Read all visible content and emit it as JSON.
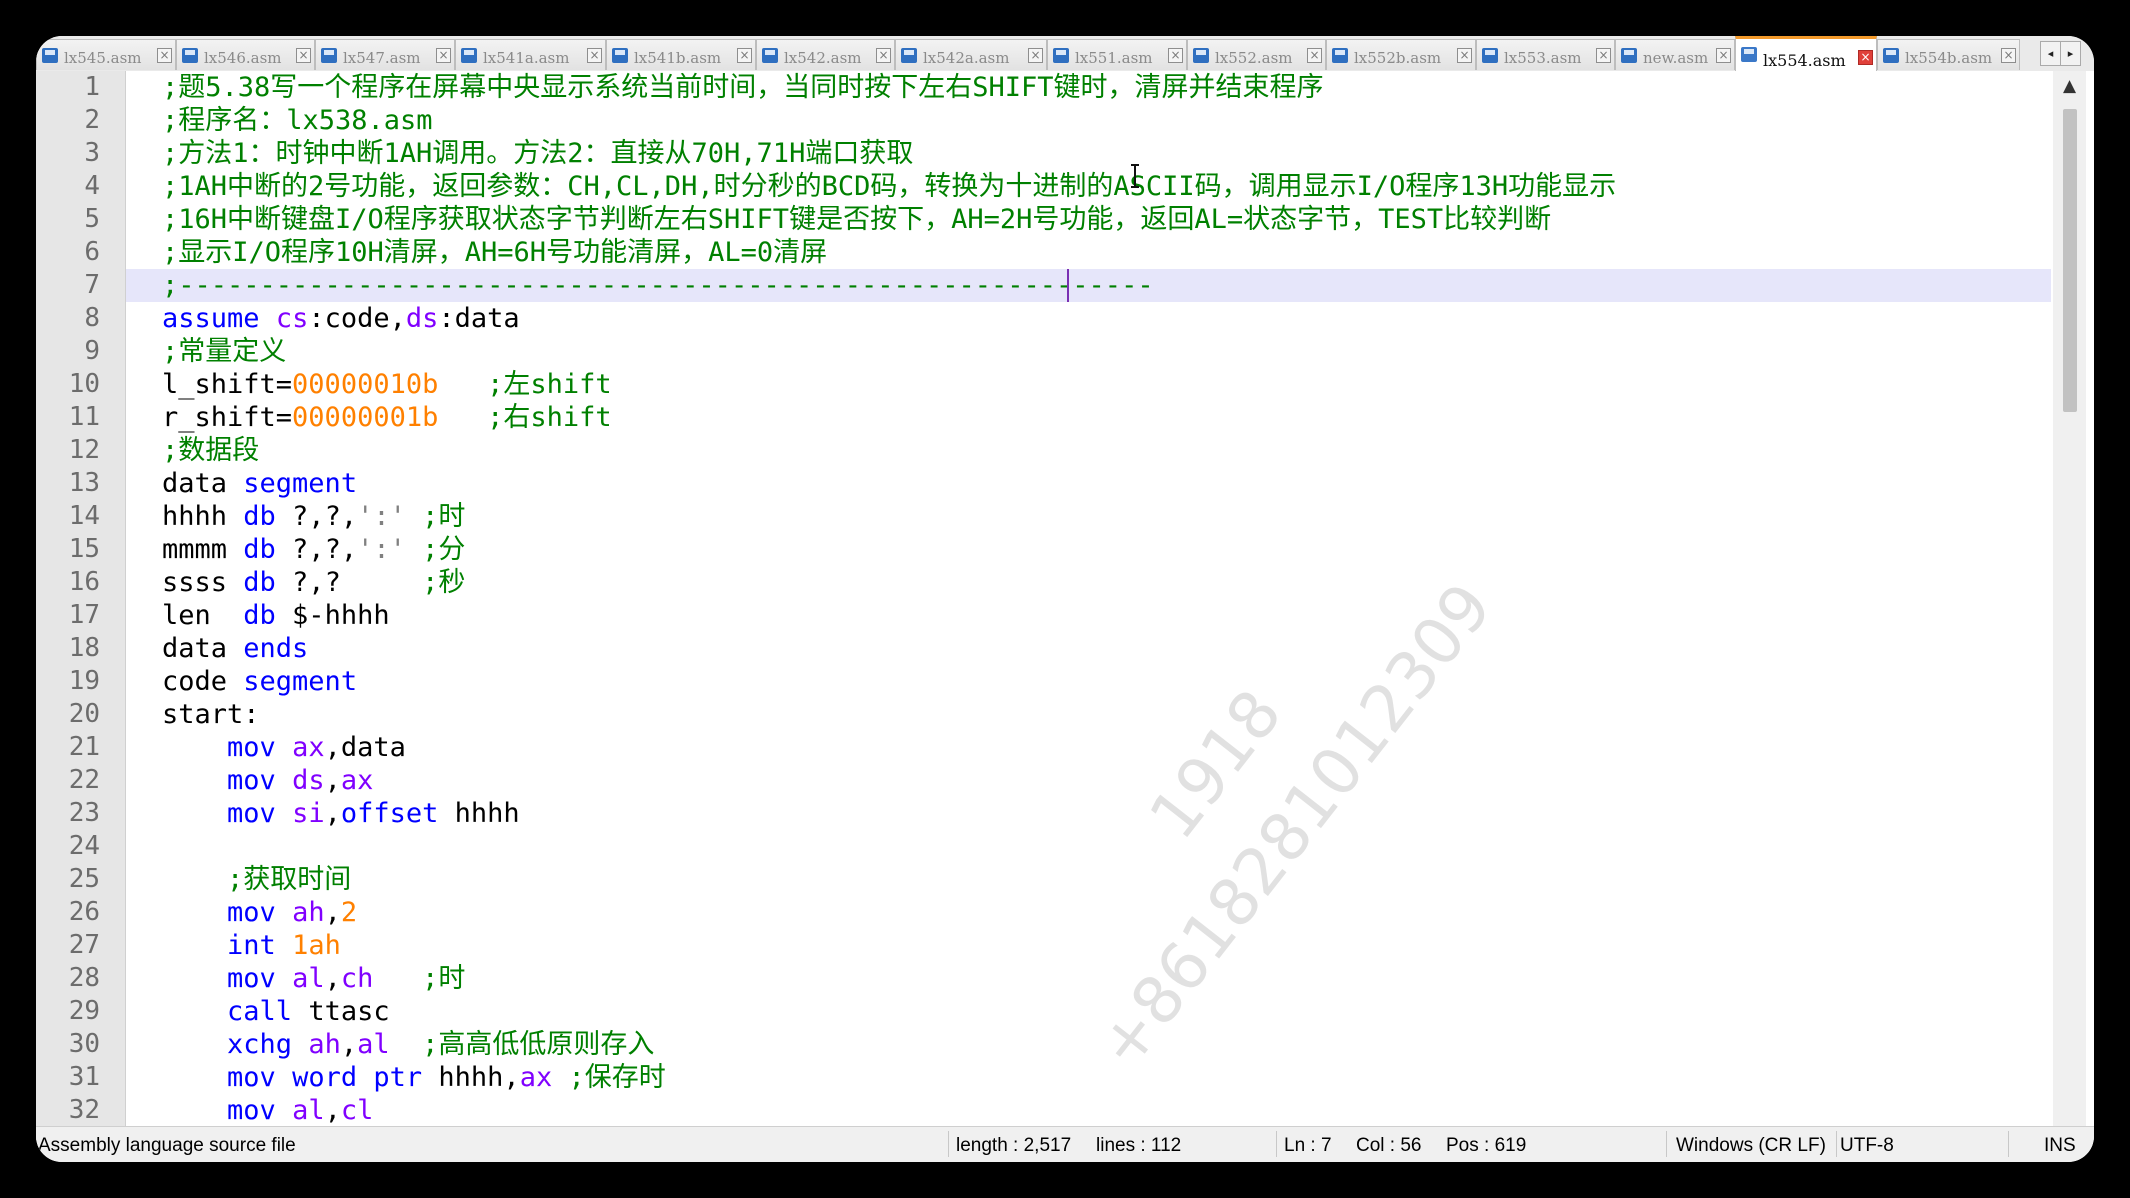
{
  "tabs": [
    {
      "label": "lx545.asm"
    },
    {
      "label": "lx546.asm"
    },
    {
      "label": "lx547.asm"
    },
    {
      "label": "lx541a.asm"
    },
    {
      "label": "lx541b.asm"
    },
    {
      "label": "lx542.asm"
    },
    {
      "label": "lx542a.asm"
    },
    {
      "label": "lx551.asm"
    },
    {
      "label": "lx552.asm"
    },
    {
      "label": "lx552b.asm"
    },
    {
      "label": "lx553.asm"
    },
    {
      "label": "new.asm"
    },
    {
      "label": "lx554.asm",
      "active": true
    },
    {
      "label": "lx554b.asm"
    }
  ],
  "tab_close": "×",
  "tab_nav": {
    "prev": "◂",
    "next": "▸"
  },
  "line_numbers": [
    "1",
    "2",
    "3",
    "4",
    "5",
    "6",
    "7",
    "8",
    "9",
    "10",
    "11",
    "12",
    "13",
    "14",
    "15",
    "16",
    "17",
    "18",
    "19",
    "20",
    "21",
    "22",
    "23",
    "24",
    "25",
    "26",
    "27",
    "28",
    "29",
    "30",
    "31",
    "32"
  ],
  "code": {
    "l1": ";题5.38写一个程序在屏幕中央显示系统当前时间，当同时按下左右SHIFT键时，清屏并结束程序",
    "l2": ";程序名：lx538.asm",
    "l3": ";方法1：时钟中断1AH调用。方法2：直接从70H,71H端口获取",
    "l4": ";1AH中断的2号功能，返回参数：CH,CL,DH,时分秒的BCD码，转换为十进制的ASCII码，调用显示I/O程序13H功能显示",
    "l5": ";16H中断键盘I/O程序获取状态字节判断左右SHIFT键是否按下，AH=2H号功能，返回AL=状态字节，TEST比较判断",
    "l6": ";显示I/O程序10H清屏，AH=6H号功能清屏，AL=0清屏",
    "l7": ";------------------------------------------------------------",
    "l8": {
      "kw1": "assume",
      "r1": "cs",
      "t1": ":code,",
      "r2": "ds",
      "t2": ":data"
    },
    "l9": ";常量定义",
    "l10": {
      "t1": "l_shift=",
      "n1": "00000010b",
      "c1": "   ;左shift"
    },
    "l11": {
      "t1": "r_shift=",
      "n1": "00000001b",
      "c1": "   ;右shift"
    },
    "l12": ";数据段",
    "l13": {
      "t1": "data ",
      "kw1": "segment"
    },
    "l14": {
      "t1": "hhhh ",
      "kw1": "db",
      "t2": " ?,?,",
      "s1": "':'",
      "c1": " ;时"
    },
    "l15": {
      "t1": "mmmm ",
      "kw1": "db",
      "t2": " ?,?,",
      "s1": "':'",
      "c1": " ;分"
    },
    "l16": {
      "t1": "ssss ",
      "kw1": "db",
      "t2": " ?,?     ",
      "c1": ";秒"
    },
    "l17": {
      "t1": "len  ",
      "kw1": "db",
      "t2": " $-hhhh"
    },
    "l18": {
      "t1": "data ",
      "kw1": "ends"
    },
    "l19": {
      "t1": "code ",
      "kw1": "segment"
    },
    "l20": "start:",
    "l21": {
      "i": "    ",
      "op": "mov",
      "sp": " ",
      "r1": "ax",
      "t1": ",data"
    },
    "l22": {
      "i": "    ",
      "op": "mov",
      "sp": " ",
      "r1": "ds",
      "t1": ",",
      "r2": "ax"
    },
    "l23": {
      "i": "    ",
      "op": "mov",
      "sp": " ",
      "r1": "si",
      "t1": ",",
      "kw1": "offset",
      "t2": " hhhh"
    },
    "l24": "",
    "l25": "    ;获取时间",
    "l26": {
      "i": "    ",
      "op": "mov",
      "sp": " ",
      "r1": "ah",
      "t1": ",",
      "n1": "2"
    },
    "l27": {
      "i": "    ",
      "op": "int",
      "sp": " ",
      "n1": "1ah"
    },
    "l28": {
      "i": "    ",
      "op": "mov",
      "sp": " ",
      "r1": "al",
      "t1": ",",
      "r2": "ch",
      "c1": "   ;时"
    },
    "l29": {
      "i": "    ",
      "op": "call",
      "t1": " ttasc"
    },
    "l30": {
      "i": "    ",
      "op": "xchg",
      "sp": " ",
      "r1": "ah",
      "t1": ",",
      "r2": "al",
      "c1": "  ;高高低低原则存入"
    },
    "l31": {
      "i": "    ",
      "op": "mov",
      "t0": " ",
      "op2": "word",
      "sp": " ",
      "kw1": "ptr",
      "t1": " hhhh,",
      "r1": "ax",
      "c1": " ;保存时"
    },
    "l32": {
      "i": "    ",
      "op": "mov",
      "sp": " ",
      "r1": "al",
      "t1": ",",
      "r2": "cl"
    }
  },
  "watermark": {
    "line1": "1918",
    "line2": "+8618281012309"
  },
  "scroll": {
    "up": "▲",
    "down": "▼"
  },
  "status": {
    "file_type": "Assembly language source file",
    "length": "length : 2,517",
    "lines": "lines : 112",
    "ln": "Ln : 7",
    "col": "Col : 56",
    "pos": "Pos : 619",
    "eol": "Windows (CR LF)",
    "encoding": "UTF-8",
    "mode": "INS"
  },
  "colors": {
    "comment": "#008000",
    "keyword": "#0000ff",
    "register": "#8000ff",
    "number": "#ff8000",
    "current_line": "#e6e6fa",
    "active_tab_accent": "#f39a2b"
  }
}
